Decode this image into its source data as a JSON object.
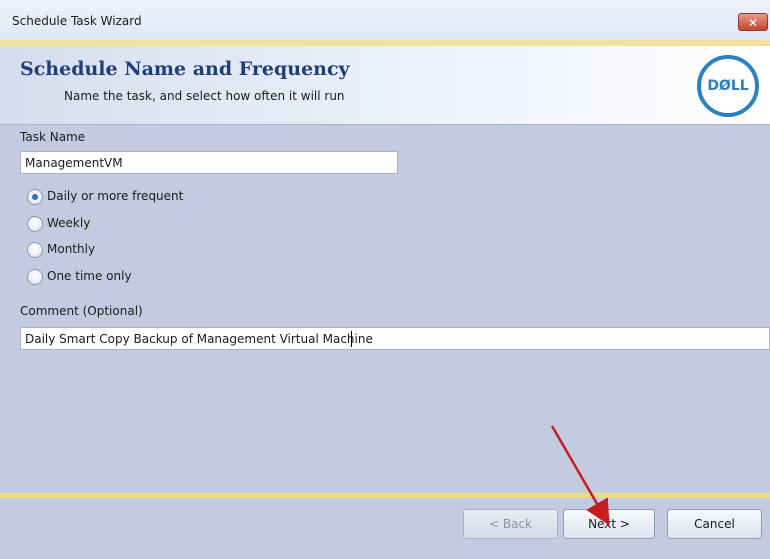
{
  "window": {
    "title": "Schedule Task Wizard",
    "close_symbol": "✕"
  },
  "header": {
    "title": "Schedule Name and Frequency",
    "subtitle": "Name the task, and select how often it will run",
    "logo_text": "DØLL"
  },
  "form": {
    "task_name_label": "Task Name",
    "task_name_value": "ManagementVM",
    "frequency_options": [
      {
        "label": "Daily or more frequent",
        "selected": true
      },
      {
        "label": "Weekly",
        "selected": false
      },
      {
        "label": "Monthly",
        "selected": false
      },
      {
        "label": "One time only",
        "selected": false
      }
    ],
    "comment_label": "Comment (Optional)",
    "comment_value": "Daily Smart Copy Backup of Management Virtual Machine"
  },
  "buttons": {
    "back": "< Back",
    "next": "Next >",
    "cancel": "Cancel"
  },
  "colors": {
    "accent": "#1f3f78",
    "dell_blue": "#2b7fc3",
    "arrow": "#c41e1e",
    "panel": "#c3cbe0",
    "gold": "#f0dc86"
  }
}
